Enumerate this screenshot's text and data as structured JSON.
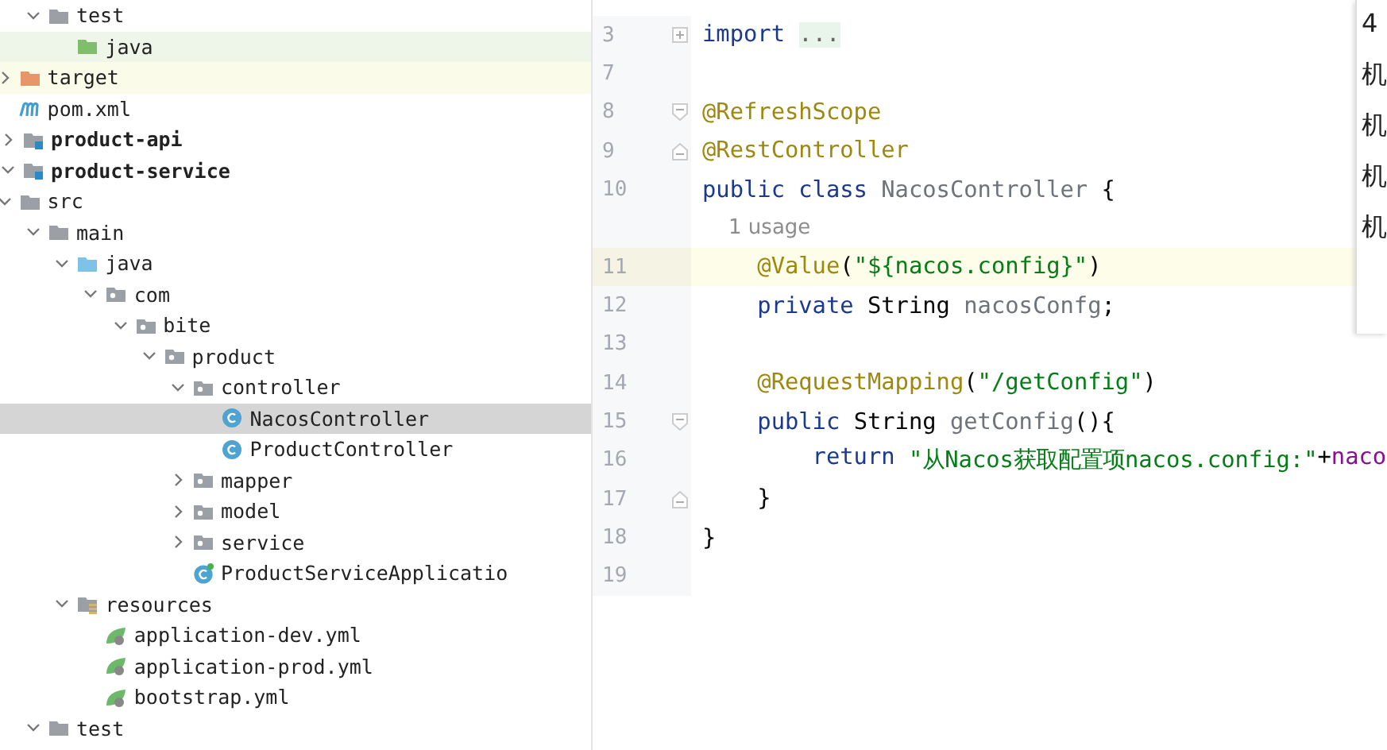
{
  "project_tree": [
    {
      "children": [
        {
          "children": [
            {
              "label": "test",
              "kind": "folder",
              "expanded": true,
              "selected": false,
              "children": [
                {
                  "label": "java",
                  "kind": "test-root",
                  "selected": false
                }
              ]
            }
          ]
        },
        {
          "label": "target",
          "kind": "excluded",
          "expanded": false,
          "selected": false
        },
        {
          "label": "pom.xml",
          "kind": "maven",
          "selected": false
        }
      ]
    },
    {
      "label": "product-api",
      "kind": "module",
      "expanded": false,
      "selected": false
    },
    {
      "label": "product-service",
      "kind": "module",
      "expanded": true,
      "selected": false,
      "children": [
        {
          "label": "src",
          "kind": "folder",
          "expanded": true,
          "selected": false,
          "children": [
            {
              "label": "main",
              "kind": "folder",
              "expanded": true,
              "selected": false,
              "children": [
                {
                  "label": "java",
                  "kind": "source-root",
                  "expanded": true,
                  "selected": false,
                  "children": [
                    {
                      "label": "com",
                      "kind": "package",
                      "expanded": true,
                      "selected": false,
                      "children": [
                        {
                          "label": "bite",
                          "kind": "package",
                          "expanded": true,
                          "selected": false,
                          "children": [
                            {
                              "label": "product",
                              "kind": "package",
                              "expanded": true,
                              "selected": false,
                              "children": [
                                {
                                  "label": "controller",
                                  "kind": "package",
                                  "expanded": true,
                                  "selected": false,
                                  "children": [
                                    {
                                      "label": "NacosController",
                                      "kind": "class",
                                      "selected": true
                                    },
                                    {
                                      "label": "ProductController",
                                      "kind": "class",
                                      "selected": false
                                    }
                                  ]
                                },
                                {
                                  "label": "mapper",
                                  "kind": "package",
                                  "expanded": false,
                                  "selected": false
                                },
                                {
                                  "label": "model",
                                  "kind": "package",
                                  "expanded": false,
                                  "selected": false
                                },
                                {
                                  "label": "service",
                                  "kind": "package",
                                  "expanded": false,
                                  "selected": false
                                },
                                {
                                  "label": "ProductServiceApplicatio",
                                  "kind": "spring-class",
                                  "selected": false
                                }
                              ]
                            }
                          ]
                        }
                      ]
                    }
                  ]
                },
                {
                  "label": "resources",
                  "kind": "resources",
                  "expanded": true,
                  "selected": false,
                  "children": [
                    {
                      "label": "application-dev.yml",
                      "kind": "yml",
                      "selected": false
                    },
                    {
                      "label": "application-prod.yml",
                      "kind": "yml",
                      "selected": false
                    },
                    {
                      "label": "bootstrap.yml",
                      "kind": "yml",
                      "selected": false
                    }
                  ]
                }
              ]
            },
            {
              "label": "test",
              "kind": "folder",
              "expanded": true,
              "selected": false
            }
          ]
        }
      ]
    }
  ],
  "editor": {
    "lines": [
      {
        "number": "3",
        "fold": {
          "kind": "collapsed"
        },
        "current": false,
        "tokens": [
          {
            "t": "import ",
            "kind": "keyword"
          },
          {
            "t": "...",
            "kind": "folded"
          }
        ]
      },
      {
        "number": "7",
        "current": false
      },
      {
        "number": "8",
        "fold": {
          "kind": "start"
        },
        "current": false,
        "tokens": [
          {
            "t": "@RefreshScope",
            "kind": "annotation"
          }
        ]
      },
      {
        "number": "9",
        "fold": {
          "kind": "end"
        },
        "current": false,
        "tokens": [
          {
            "t": "@RestController",
            "kind": "annotation"
          }
        ]
      },
      {
        "number": "10",
        "current": false,
        "tokens": [
          {
            "t": "public class ",
            "kind": "keyword"
          },
          {
            "t": "NacosController",
            "kind": "unused"
          },
          {
            "t": " {",
            "kind": "plain"
          }
        ]
      },
      {
        "current": false,
        "tokens": [
          {
            "t": "    1 usage",
            "kind": "hint"
          }
        ]
      },
      {
        "number": "11",
        "current": true,
        "tokens": [
          {
            "t": "    @Value",
            "kind": "annotation"
          },
          {
            "t": "(",
            "kind": "plain"
          },
          {
            "t": "\"${nacos.config}\"",
            "kind": "string"
          },
          {
            "t": ")",
            "kind": "plain"
          }
        ]
      },
      {
        "number": "12",
        "current": false,
        "tokens": [
          {
            "t": "    private ",
            "kind": "keyword"
          },
          {
            "t": "String ",
            "kind": "plain"
          },
          {
            "t": "nacosConfg",
            "kind": "unused"
          },
          {
            "t": ";",
            "kind": "plain"
          }
        ]
      },
      {
        "number": "13",
        "current": false
      },
      {
        "number": "14",
        "current": false,
        "tokens": [
          {
            "t": "    @RequestMapping",
            "kind": "annotation"
          },
          {
            "t": "(",
            "kind": "plain"
          },
          {
            "t": "\"/getConfig\"",
            "kind": "string"
          },
          {
            "t": ")",
            "kind": "plain"
          }
        ]
      },
      {
        "number": "15",
        "fold": {
          "kind": "start"
        },
        "current": false,
        "tokens": [
          {
            "t": "    public ",
            "kind": "keyword"
          },
          {
            "t": "String ",
            "kind": "plain"
          },
          {
            "t": "getConfig",
            "kind": "unused"
          },
          {
            "t": "(){",
            "kind": "plain"
          }
        ]
      },
      {
        "number": "16",
        "current": false,
        "tokens": [
          {
            "t": "        return ",
            "kind": "keyword"
          },
          {
            "t": "\"从Nacos获取配置项nacos.config:\"",
            "kind": "string"
          },
          {
            "t": "+",
            "kind": "plain"
          },
          {
            "t": "naco",
            "kind": "field"
          }
        ]
      },
      {
        "number": "17",
        "fold": {
          "kind": "end"
        },
        "current": false,
        "tokens": [
          {
            "t": "    }",
            "kind": "plain"
          }
        ]
      },
      {
        "number": "18",
        "current": false,
        "tokens": [
          {
            "t": "}",
            "kind": "plain"
          }
        ]
      },
      {
        "number": "19",
        "current": false
      }
    ]
  },
  "popup": {
    "items": [
      "4",
      "机",
      "机",
      "机",
      "机"
    ]
  }
}
